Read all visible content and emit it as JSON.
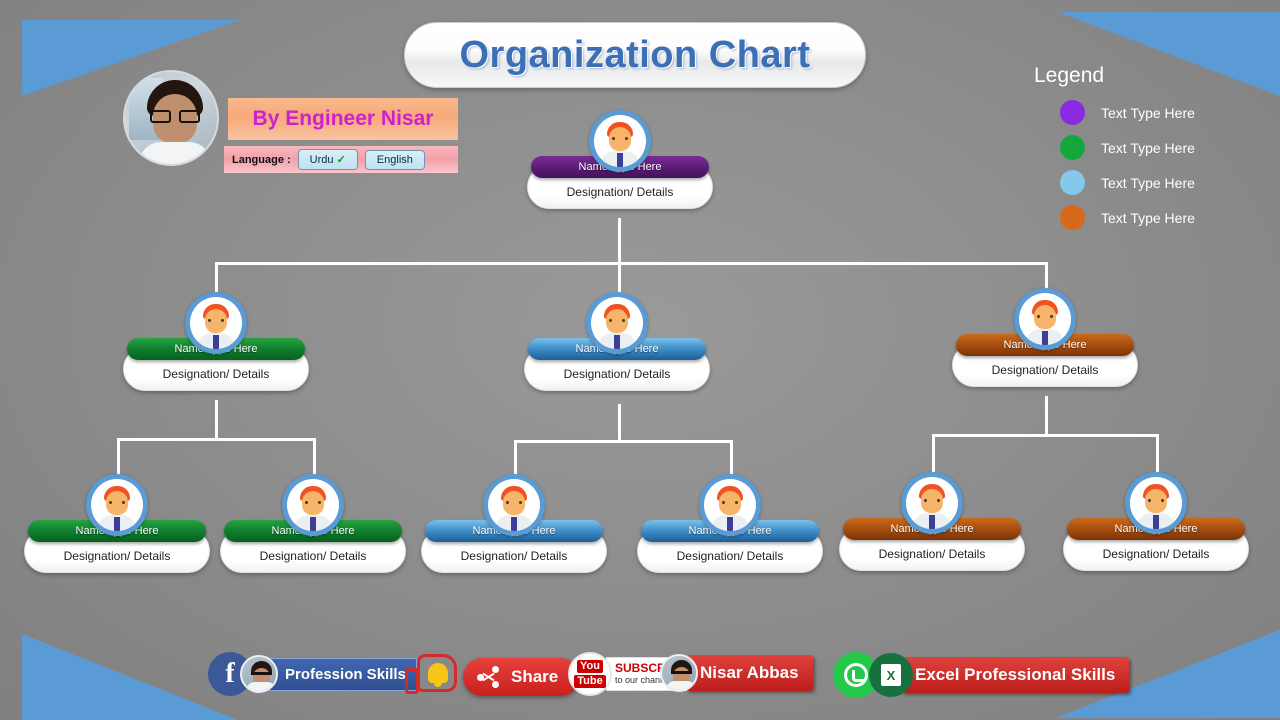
{
  "header": {
    "title": "Organization Chart"
  },
  "author": {
    "byline": "By Engineer Nisar",
    "language_label": "Language :",
    "lang_urdu": "Urdu",
    "lang_urdu_check": "✓",
    "lang_english": "English"
  },
  "legend": {
    "title": "Legend",
    "items": [
      {
        "label": "Text Type Here",
        "color": "#8a2be2"
      },
      {
        "label": "Text Type Here",
        "color": "#14a83c"
      },
      {
        "label": "Text Type Here",
        "color": "#86c8ea"
      },
      {
        "label": "Text Type Here",
        "color": "#d9691a"
      }
    ]
  },
  "chart_data": {
    "type": "org-chart",
    "title": "Organization Chart",
    "name_placeholder": "Name Type Here",
    "detail_placeholder": "Designation/ Details",
    "levels": 3,
    "nodes": [
      {
        "id": "root",
        "level": 1,
        "color": "#5d1f78",
        "color_name": "purple",
        "name": "Name Type Here",
        "detail": "Designation/ Details",
        "parent": null
      },
      {
        "id": "l2-a",
        "level": 2,
        "color": "#108030",
        "color_name": "green",
        "name": "Name Type Here",
        "detail": "Designation/ Details",
        "parent": "root"
      },
      {
        "id": "l2-b",
        "level": 2,
        "color": "#3f8fc9",
        "color_name": "blue",
        "name": "Name Type Here",
        "detail": "Designation/ Details",
        "parent": "root"
      },
      {
        "id": "l2-c",
        "level": 2,
        "color": "#a94e10",
        "color_name": "orange",
        "name": "Name Type Here",
        "detail": "Designation/ Details",
        "parent": "root"
      },
      {
        "id": "l3-a1",
        "level": 3,
        "color": "#108030",
        "color_name": "green",
        "name": "Name Type Here",
        "detail": "Designation/ Details",
        "parent": "l2-a"
      },
      {
        "id": "l3-a2",
        "level": 3,
        "color": "#108030",
        "color_name": "green",
        "name": "Name Type Here",
        "detail": "Designation/ Details",
        "parent": "l2-a"
      },
      {
        "id": "l3-b1",
        "level": 3,
        "color": "#3f8fc9",
        "color_name": "blue",
        "name": "Name Type Here",
        "detail": "Designation/ Details",
        "parent": "l2-b"
      },
      {
        "id": "l3-b2",
        "level": 3,
        "color": "#3f8fc9",
        "color_name": "blue",
        "name": "Name Type Here",
        "detail": "Designation/ Details",
        "parent": "l2-b"
      },
      {
        "id": "l3-c1",
        "level": 3,
        "color": "#a94e10",
        "color_name": "orange",
        "name": "Name Type Here",
        "detail": "Designation/ Details",
        "parent": "l2-c"
      },
      {
        "id": "l3-c2",
        "level": 3,
        "color": "#a94e10",
        "color_name": "orange",
        "name": "Name Type Here",
        "detail": "Designation/ Details",
        "parent": "l2-c"
      }
    ]
  },
  "footer": {
    "facebook_label": "Profession Skills",
    "share_label": "Share",
    "youtube_sub": "SUBSCRIBE",
    "youtube_sub2": "to our channel",
    "youtube_you": "You",
    "youtube_tube": "Tube",
    "channel_name": "Nisar Abbas",
    "whatsapp_label": "Excel Professional Skills",
    "office_letter": "X"
  },
  "theme": {
    "background": "#8e8e8e",
    "accent_blue": "#5a9bd5",
    "title_color": "#3b6fb6",
    "connector": "#ffffff"
  }
}
